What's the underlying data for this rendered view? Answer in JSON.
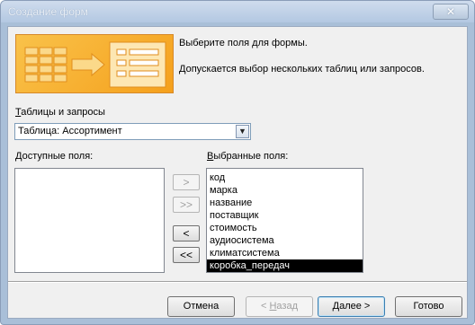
{
  "window": {
    "title": "Создание форм",
    "close_symbol": "✕"
  },
  "header": {
    "line1": "Выберите поля для формы.",
    "line2": "Допускается выбор нескольких таблиц или запросов."
  },
  "source": {
    "label_accel": "Т",
    "label_rest": "аблицы и запросы",
    "value": "Таблица: Ассортимент"
  },
  "available": {
    "label_accel": "Д",
    "label_rest": "оступные поля:",
    "items": []
  },
  "selected": {
    "label_accel": "В",
    "label_rest": "ыбранные поля:",
    "items": [
      "код",
      "марка",
      "название",
      "поставщик",
      "стоимость",
      "аудиосистема",
      "климатсистема",
      "коробка_передач"
    ],
    "selected_item": "коробка_передач"
  },
  "move_buttons": {
    "add_one": ">",
    "add_all": ">>",
    "remove_one": "<",
    "remove_all": "<<"
  },
  "buttons": {
    "cancel": "Отмена",
    "back_accel": "Н",
    "back_rest": "азад",
    "back_prefix": "< ",
    "next_accel": "Д",
    "next_rest": "алее >",
    "finish": "Готово"
  },
  "colors": {
    "titlebar": "#b3c8e2",
    "header_image": "#f5a01c",
    "selection": "#000000"
  }
}
